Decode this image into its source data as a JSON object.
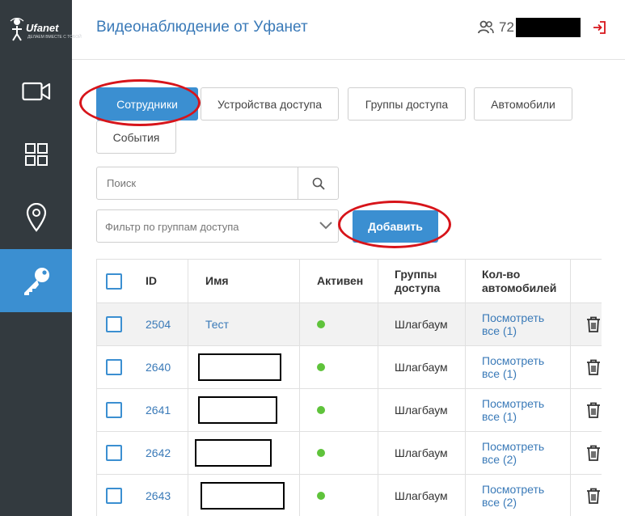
{
  "app": {
    "logo_text": "Ufanet",
    "logo_tagline": "ДЕЛАЕМ ВМЕСТЕ С ТОБОЙ",
    "page_title": "Видеонаблюдение от Уфанет",
    "user_id": "72",
    "accent_color": "#3b8fd1"
  },
  "sidebar": {
    "items": [
      {
        "name": "video",
        "icon": "camera-icon",
        "active": false
      },
      {
        "name": "grid",
        "icon": "grid-icon",
        "active": false
      },
      {
        "name": "map",
        "icon": "map-pin-icon",
        "active": false
      },
      {
        "name": "access",
        "icon": "key-icon",
        "active": true
      }
    ]
  },
  "tabs": [
    {
      "label": "Сотрудники",
      "active": true
    },
    {
      "label": "Устройства доступа",
      "active": false
    },
    {
      "label": "Группы доступа",
      "active": false
    },
    {
      "label": "Автомобили",
      "active": false
    },
    {
      "label": "События",
      "active": false
    }
  ],
  "search": {
    "placeholder": "Поиск",
    "value": ""
  },
  "filter": {
    "placeholder": "Фильтр по группам доступа"
  },
  "add_button": {
    "label": "Добавить"
  },
  "table": {
    "headers": {
      "id": "ID",
      "name": "Имя",
      "active": "Активен",
      "groups": "Группы доступа",
      "cars": "Кол-во автомобилей"
    },
    "rows": [
      {
        "id": "2504",
        "name": "Тест",
        "active": true,
        "group": "Шлагбаум",
        "cars_link": "Посмотреть все (1)"
      },
      {
        "id": "2640",
        "name": "",
        "active": true,
        "group": "Шлагбаум",
        "cars_link": "Посмотреть все (1)"
      },
      {
        "id": "2641",
        "name": "",
        "active": true,
        "group": "Шлагбаум",
        "cars_link": "Посмотреть все (1)"
      },
      {
        "id": "2642",
        "name": "",
        "active": true,
        "group": "Шлагбаум",
        "cars_link": "Посмотреть все (2)"
      },
      {
        "id": "2643",
        "name": "",
        "active": true,
        "group": "Шлагбаум",
        "cars_link": "Посмотреть все (2)"
      }
    ]
  }
}
